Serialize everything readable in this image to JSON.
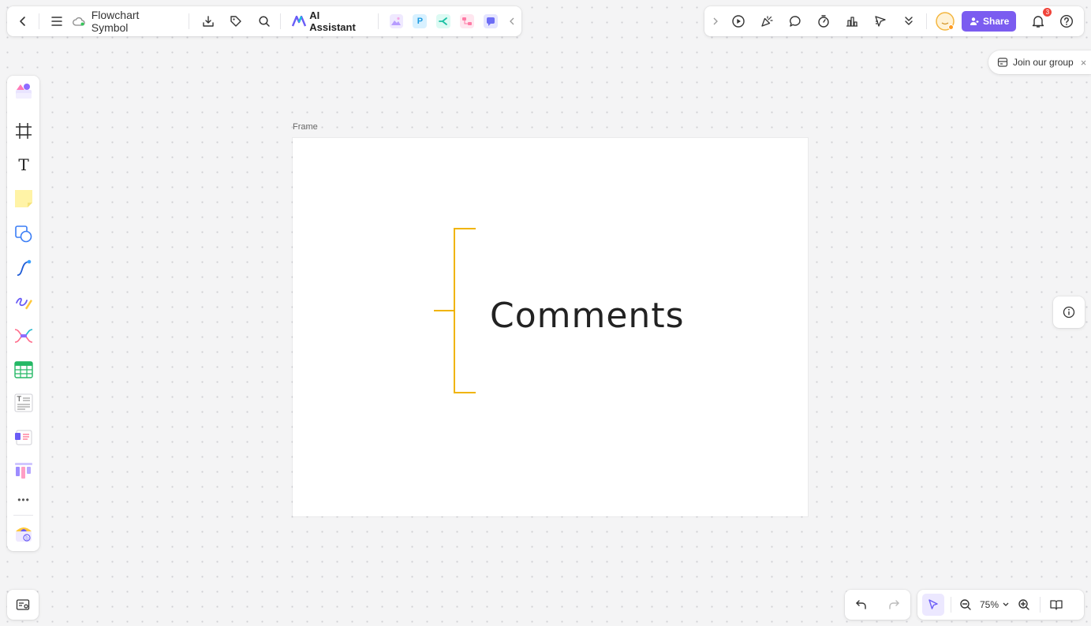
{
  "topbar": {
    "doc_title": "Flowchart Symbol",
    "ai_label": "AI Assistant",
    "app_icons": [
      "image-ai-icon",
      "p-app-icon",
      "flow-app-icon",
      "mindmap-app-icon",
      "chat-app-icon"
    ],
    "p_glyph": "P"
  },
  "topbar_right": {
    "share_label": "Share",
    "notification_count": "3"
  },
  "join_group": {
    "label": "Join our group",
    "close_glyph": "×"
  },
  "canvas": {
    "frame_label": "Frame",
    "shape_text": "Comments",
    "bracket_color": "#f0b400"
  },
  "left_toolbar": {
    "items": [
      "templates",
      "frame",
      "text",
      "sticky-note",
      "shapes",
      "connector",
      "pen",
      "mind-map",
      "table",
      "text-list",
      "card",
      "kanban",
      "more",
      "plugins"
    ],
    "text_glyph": "T",
    "more_glyph": "•••"
  },
  "zoom": {
    "value": "75%"
  },
  "colors": {
    "accent": "#7b5cf0",
    "badge": "#f0443a",
    "bracket": "#f0b400"
  }
}
